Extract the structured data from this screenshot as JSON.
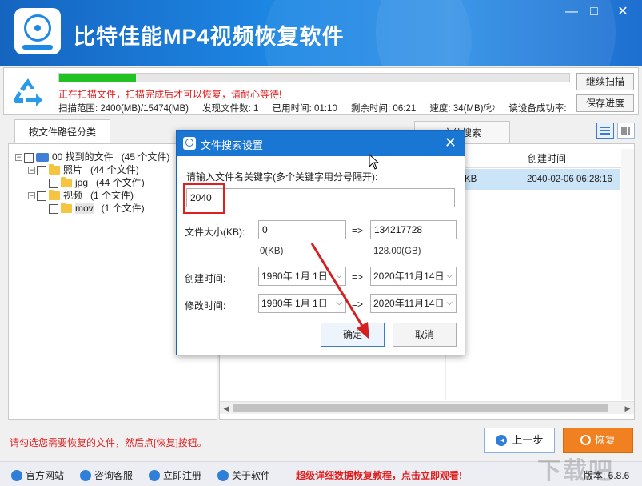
{
  "app": {
    "title": "比特佳能MP4视频恢复软件"
  },
  "window": {
    "minimize": "—",
    "restore": "□",
    "close": "✕"
  },
  "scan": {
    "progress_pct": 15,
    "message": "正在扫描文件，扫描完成后才可以恢复，请耐心等待!",
    "range": "扫描范围: 2400(MB)/15474(MB)",
    "found": "发现文件数: 1",
    "elapsed": "已用时间: 01:10",
    "remaining": "剩余时间: 06:21",
    "speed": "速度: 34(MB)/秒",
    "success_rate": "读设备成功率:",
    "continue_btn": "继续扫描",
    "save_btn": "保存进度"
  },
  "tabs": {
    "left": "按文件路径分类",
    "right": "文件搜索"
  },
  "tree": [
    {
      "label": "00 找到的文件",
      "count": "(45 个文件)"
    },
    {
      "label": "照片",
      "count": "(44 个文件)"
    },
    {
      "label": "jpg",
      "count": "(44 个文件)"
    },
    {
      "label": "视频",
      "count": "(1 个文件)"
    },
    {
      "label": "mov",
      "count": "(1 个文件)"
    }
  ],
  "list": {
    "header_created": "创建时间",
    "row": {
      "size": "01 KB",
      "created": "2040-02-06 06:28:16"
    }
  },
  "dialog": {
    "title": "文件搜索设置",
    "close": "✕",
    "keyword_label": "请输入文件名关键字(多个关键字用分号隔开):",
    "keyword_value": "2040",
    "size_label": "文件大小(KB):",
    "size_min": "0",
    "size_max": "134217728",
    "size_min_unit": "0(KB)",
    "size_max_unit": "128.00(GB)",
    "arrow": "=>",
    "created_label": "创建时间:",
    "modified_label": "修改时间:",
    "date_from": "1980年  1月  1日",
    "date_to": "2020年11月14日",
    "ok": "确定",
    "cancel": "取消"
  },
  "bottom": {
    "hint": "请勾选您需要恢复的文件，然后点[恢复]按钮。",
    "prev": "上一步",
    "recover": "恢复"
  },
  "footer": {
    "links": [
      "官方网站",
      "咨询客服",
      "立即注册",
      "关于软件"
    ],
    "promo": "超级详细数据恢复教程，点击立即观看!",
    "version": "版本: 6.8.6",
    "watermark": "下载吧"
  },
  "colors": {
    "accent": "#1976d2",
    "progress": "#23c223",
    "warning": "#e02020",
    "recover": "#f08020"
  }
}
